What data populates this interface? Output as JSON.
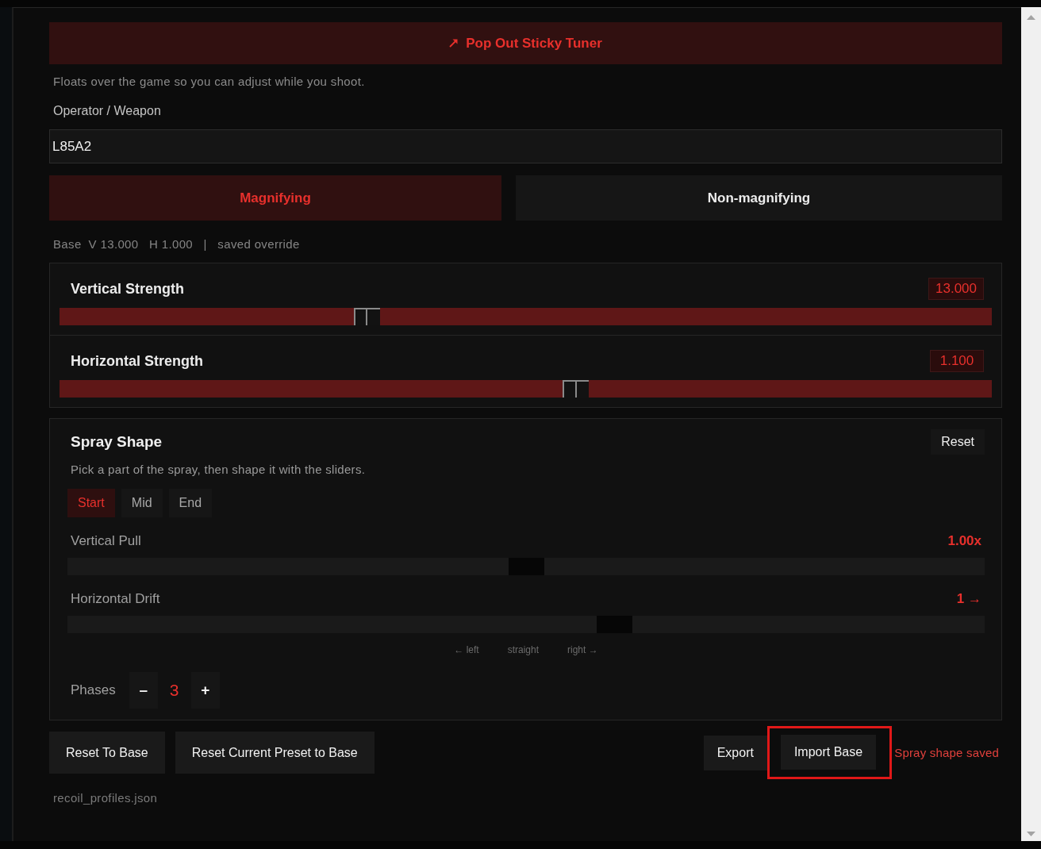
{
  "pop_out_button": {
    "label": "Pop Out Sticky Tuner"
  },
  "hint": "Floats over the game so you can adjust while you shoot.",
  "weapon_field": {
    "label": "Operator / Weapon",
    "value": "L85A2"
  },
  "scope_modes": [
    {
      "label": "Magnifying",
      "selected": true
    },
    {
      "label": "Non-magnifying",
      "selected": false
    }
  ],
  "base_info": "Base  V 13.000   H 1.000   |   saved override",
  "strength_sliders": [
    {
      "label": "Vertical Strength",
      "value": "13.000",
      "level": 0.325
    },
    {
      "label": "Horizontal Strength",
      "value": "1.100",
      "level": 0.555
    }
  ],
  "spray_shape": {
    "title": "Spray Shape",
    "reset_label": "Reset",
    "description": "Pick a part of the spray, then shape it with the sliders.",
    "parts": [
      {
        "label": "Start",
        "selected": true
      },
      {
        "label": "Mid",
        "selected": false
      },
      {
        "label": "End",
        "selected": false
      }
    ],
    "sliders": [
      {
        "label": "Vertical Pull",
        "value": "1.00x",
        "level": 0.5
      },
      {
        "label": "Horizontal Drift",
        "value": "1 →",
        "level": 0.6,
        "scale_labels": [
          "← left",
          "straight",
          "right →"
        ]
      }
    ],
    "phases": {
      "label": "Phases",
      "decrement": "–",
      "value": "3",
      "increment": "+"
    }
  },
  "left_actions": [
    "Reset To Base",
    "Reset Current Preset to Base"
  ],
  "right_actions": [
    {
      "label": "Export",
      "highlighted": false
    },
    {
      "label": "Import Base",
      "highlighted": true
    }
  ],
  "status": "Spray shape saved",
  "file_name": "recoil_profiles.json"
}
